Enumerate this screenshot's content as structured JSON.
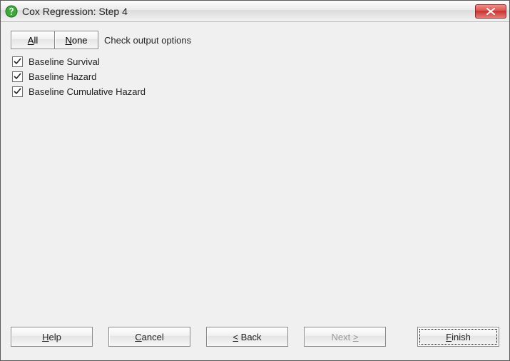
{
  "window": {
    "title": "Cox Regression: Step 4"
  },
  "toolbar": {
    "all_label": "All",
    "none_label": "None",
    "hint": "Check output options"
  },
  "options": [
    {
      "label": "Baseline Survival",
      "checked": true
    },
    {
      "label": "Baseline Hazard",
      "checked": true
    },
    {
      "label": "Baseline Cumulative Hazard",
      "checked": true
    }
  ],
  "buttons": {
    "help": "Help",
    "cancel": "Cancel",
    "back": "Back",
    "next": "Next",
    "finish": "Finish"
  },
  "back_prefix": "< ",
  "next_suffix": " >",
  "mnemonic": {
    "help": "H",
    "cancel": "C",
    "back": "<",
    "next": ">",
    "finish": "F",
    "all": "A",
    "none": "N"
  }
}
